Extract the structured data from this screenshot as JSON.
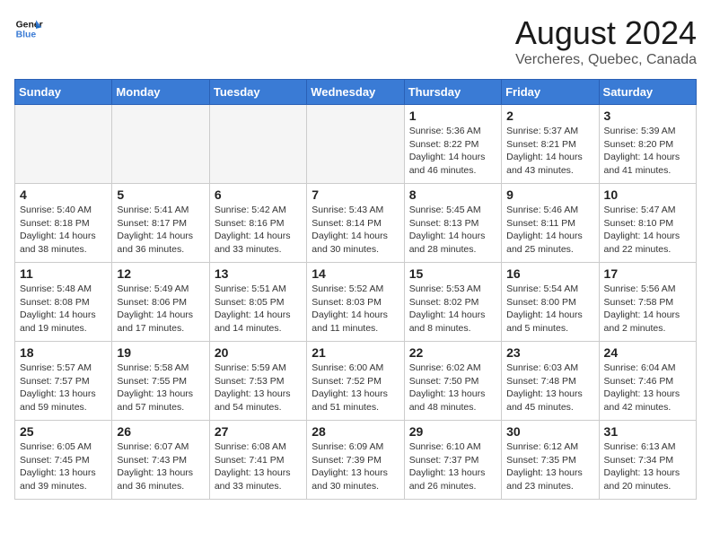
{
  "header": {
    "logo_line1": "General",
    "logo_line2": "Blue",
    "month": "August 2024",
    "location": "Vercheres, Quebec, Canada"
  },
  "weekdays": [
    "Sunday",
    "Monday",
    "Tuesday",
    "Wednesday",
    "Thursday",
    "Friday",
    "Saturday"
  ],
  "weeks": [
    [
      {
        "day": "",
        "info": ""
      },
      {
        "day": "",
        "info": ""
      },
      {
        "day": "",
        "info": ""
      },
      {
        "day": "",
        "info": ""
      },
      {
        "day": "1",
        "info": "Sunrise: 5:36 AM\nSunset: 8:22 PM\nDaylight: 14 hours\nand 46 minutes."
      },
      {
        "day": "2",
        "info": "Sunrise: 5:37 AM\nSunset: 8:21 PM\nDaylight: 14 hours\nand 43 minutes."
      },
      {
        "day": "3",
        "info": "Sunrise: 5:39 AM\nSunset: 8:20 PM\nDaylight: 14 hours\nand 41 minutes."
      }
    ],
    [
      {
        "day": "4",
        "info": "Sunrise: 5:40 AM\nSunset: 8:18 PM\nDaylight: 14 hours\nand 38 minutes."
      },
      {
        "day": "5",
        "info": "Sunrise: 5:41 AM\nSunset: 8:17 PM\nDaylight: 14 hours\nand 36 minutes."
      },
      {
        "day": "6",
        "info": "Sunrise: 5:42 AM\nSunset: 8:16 PM\nDaylight: 14 hours\nand 33 minutes."
      },
      {
        "day": "7",
        "info": "Sunrise: 5:43 AM\nSunset: 8:14 PM\nDaylight: 14 hours\nand 30 minutes."
      },
      {
        "day": "8",
        "info": "Sunrise: 5:45 AM\nSunset: 8:13 PM\nDaylight: 14 hours\nand 28 minutes."
      },
      {
        "day": "9",
        "info": "Sunrise: 5:46 AM\nSunset: 8:11 PM\nDaylight: 14 hours\nand 25 minutes."
      },
      {
        "day": "10",
        "info": "Sunrise: 5:47 AM\nSunset: 8:10 PM\nDaylight: 14 hours\nand 22 minutes."
      }
    ],
    [
      {
        "day": "11",
        "info": "Sunrise: 5:48 AM\nSunset: 8:08 PM\nDaylight: 14 hours\nand 19 minutes."
      },
      {
        "day": "12",
        "info": "Sunrise: 5:49 AM\nSunset: 8:06 PM\nDaylight: 14 hours\nand 17 minutes."
      },
      {
        "day": "13",
        "info": "Sunrise: 5:51 AM\nSunset: 8:05 PM\nDaylight: 14 hours\nand 14 minutes."
      },
      {
        "day": "14",
        "info": "Sunrise: 5:52 AM\nSunset: 8:03 PM\nDaylight: 14 hours\nand 11 minutes."
      },
      {
        "day": "15",
        "info": "Sunrise: 5:53 AM\nSunset: 8:02 PM\nDaylight: 14 hours\nand 8 minutes."
      },
      {
        "day": "16",
        "info": "Sunrise: 5:54 AM\nSunset: 8:00 PM\nDaylight: 14 hours\nand 5 minutes."
      },
      {
        "day": "17",
        "info": "Sunrise: 5:56 AM\nSunset: 7:58 PM\nDaylight: 14 hours\nand 2 minutes."
      }
    ],
    [
      {
        "day": "18",
        "info": "Sunrise: 5:57 AM\nSunset: 7:57 PM\nDaylight: 13 hours\nand 59 minutes."
      },
      {
        "day": "19",
        "info": "Sunrise: 5:58 AM\nSunset: 7:55 PM\nDaylight: 13 hours\nand 57 minutes."
      },
      {
        "day": "20",
        "info": "Sunrise: 5:59 AM\nSunset: 7:53 PM\nDaylight: 13 hours\nand 54 minutes."
      },
      {
        "day": "21",
        "info": "Sunrise: 6:00 AM\nSunset: 7:52 PM\nDaylight: 13 hours\nand 51 minutes."
      },
      {
        "day": "22",
        "info": "Sunrise: 6:02 AM\nSunset: 7:50 PM\nDaylight: 13 hours\nand 48 minutes."
      },
      {
        "day": "23",
        "info": "Sunrise: 6:03 AM\nSunset: 7:48 PM\nDaylight: 13 hours\nand 45 minutes."
      },
      {
        "day": "24",
        "info": "Sunrise: 6:04 AM\nSunset: 7:46 PM\nDaylight: 13 hours\nand 42 minutes."
      }
    ],
    [
      {
        "day": "25",
        "info": "Sunrise: 6:05 AM\nSunset: 7:45 PM\nDaylight: 13 hours\nand 39 minutes."
      },
      {
        "day": "26",
        "info": "Sunrise: 6:07 AM\nSunset: 7:43 PM\nDaylight: 13 hours\nand 36 minutes."
      },
      {
        "day": "27",
        "info": "Sunrise: 6:08 AM\nSunset: 7:41 PM\nDaylight: 13 hours\nand 33 minutes."
      },
      {
        "day": "28",
        "info": "Sunrise: 6:09 AM\nSunset: 7:39 PM\nDaylight: 13 hours\nand 30 minutes."
      },
      {
        "day": "29",
        "info": "Sunrise: 6:10 AM\nSunset: 7:37 PM\nDaylight: 13 hours\nand 26 minutes."
      },
      {
        "day": "30",
        "info": "Sunrise: 6:12 AM\nSunset: 7:35 PM\nDaylight: 13 hours\nand 23 minutes."
      },
      {
        "day": "31",
        "info": "Sunrise: 6:13 AM\nSunset: 7:34 PM\nDaylight: 13 hours\nand 20 minutes."
      }
    ]
  ]
}
